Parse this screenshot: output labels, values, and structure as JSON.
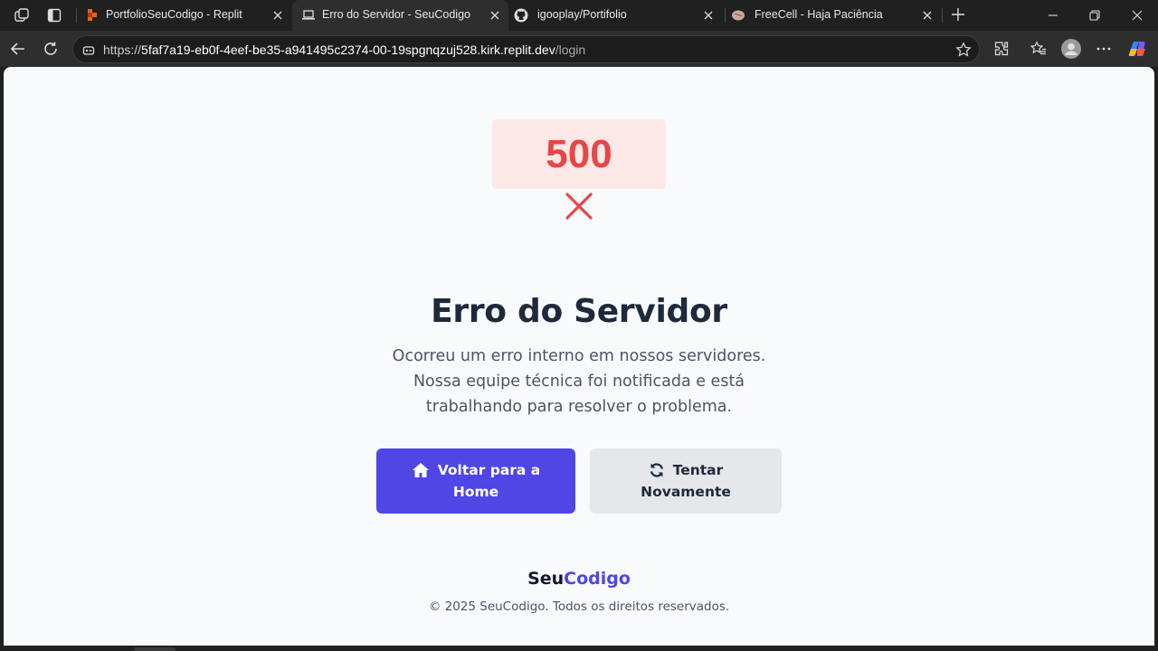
{
  "browser": {
    "tabs": [
      {
        "title": "PortfolioSeuCodigo - Replit",
        "favicon": "replit-icon",
        "active": false
      },
      {
        "title": "Erro do Servidor - SeuCodigo",
        "favicon": "laptop-icon",
        "active": true
      },
      {
        "title": "igooplay/Portifolio",
        "favicon": "github-icon",
        "active": false
      },
      {
        "title": "FreeCell - Haja Paciência",
        "favicon": "brain-icon",
        "active": false
      }
    ],
    "url_prefix": "https://",
    "url_host": "5faf7a19-eb0f-4eef-be35-a941495c2374-00-19spgnqzuj528.kirk.replit.dev",
    "url_path": "/login"
  },
  "page": {
    "error_code": "500",
    "title": "Erro do Servidor",
    "description": "Ocorreu um erro interno em nossos servidores. Nossa equipe técnica foi notificada e está trabalhando para resolver o problema.",
    "home_button": {
      "line1": "Voltar para a",
      "line2": "Home",
      "icon": "home-icon"
    },
    "retry_button": {
      "line1": "Tentar",
      "line2": "Novamente",
      "icon": "refresh-icon"
    },
    "brand_part1": "Seu",
    "brand_part2": "Codigo",
    "copyright": "© 2025 SeuCodigo. Todos os direitos reservados."
  },
  "colors": {
    "accent": "#4f46e5",
    "error_red": "#e84646",
    "error_bg": "#fde8e8",
    "page_bg": "#f8fafc"
  }
}
